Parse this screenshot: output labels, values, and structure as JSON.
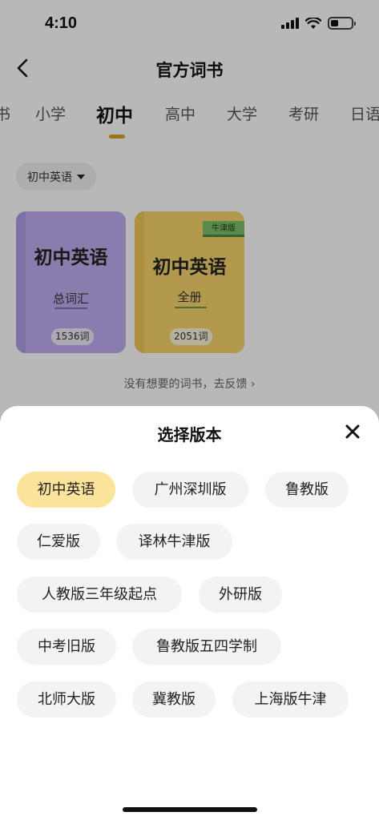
{
  "status_bar": {
    "time": "4:10"
  },
  "nav": {
    "title": "官方词书"
  },
  "tabs": [
    {
      "label": "书"
    },
    {
      "label": "小学"
    },
    {
      "label": "初中"
    },
    {
      "label": "高中"
    },
    {
      "label": "大学"
    },
    {
      "label": "考研"
    },
    {
      "label": "日语"
    }
  ],
  "filter": {
    "label": "初中英语"
  },
  "books": [
    {
      "title": "初中英语",
      "subtitle": "总词汇",
      "count": "1536词",
      "color": "#bfaef0"
    },
    {
      "title": "初中英语",
      "subtitle": "全册",
      "count": "2051词",
      "tag": "牛津版",
      "color": "#f7d56b"
    }
  ],
  "feedback": {
    "text": "没有想要的词书，去反馈 ›"
  },
  "sheet": {
    "title": "选择版本",
    "selected_color": "#fbe39a",
    "options": [
      "初中英语",
      "广州深圳版",
      "鲁教版",
      "仁爱版",
      "译林牛津版",
      "人教版三年级起点",
      "外研版",
      "中考旧版",
      "鲁教版五四学制",
      "北师大版",
      "冀教版",
      "上海版牛津"
    ],
    "selected_option": "初中英语"
  }
}
